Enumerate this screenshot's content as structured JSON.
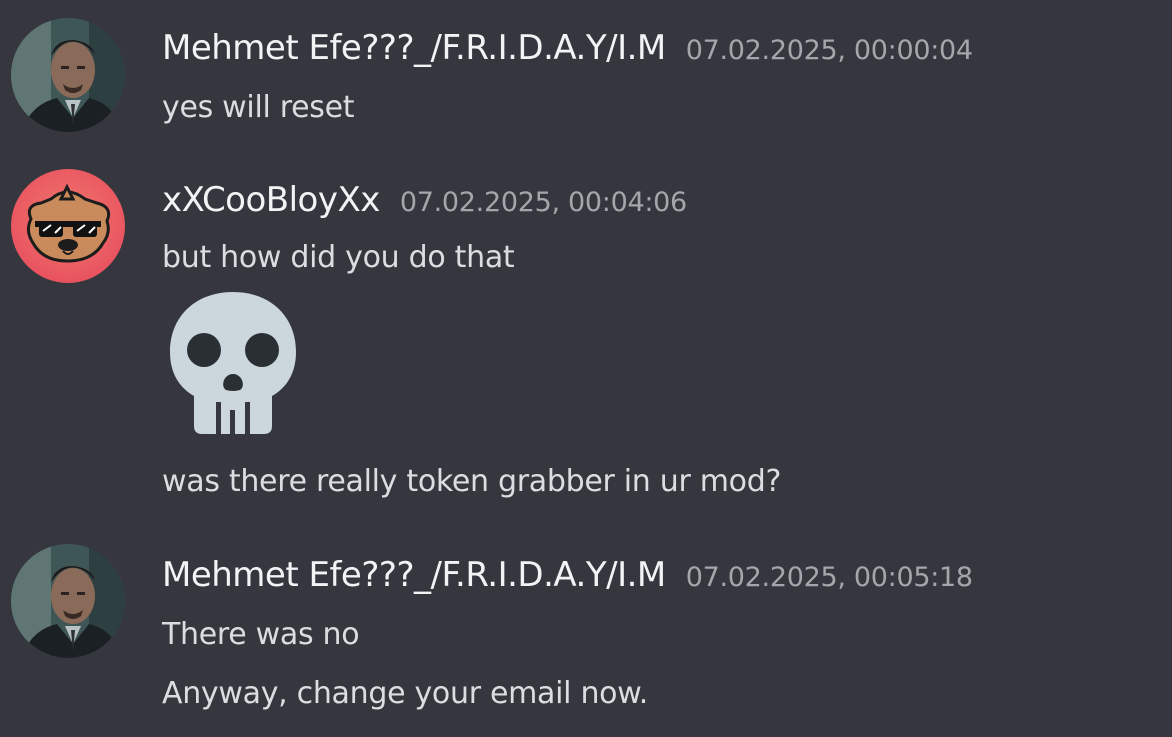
{
  "messages": [
    {
      "author": "Mehmet Efe???_/F.R.I.D.A.Y/I.M",
      "timestamp": "07.02.2025, 00:00:04",
      "lines": [
        "yes will reset"
      ]
    },
    {
      "author": "xXCooBloyXx",
      "timestamp": "07.02.2025, 00:04:06",
      "lines": [
        "but how did you do that",
        "was there really token grabber in ur mod?"
      ],
      "emoji": "skull-emoji"
    },
    {
      "author": "Mehmet Efe???_/F.R.I.D.A.Y/I.M",
      "timestamp": "07.02.2025, 00:05:18",
      "lines": [
        "There was no",
        "Anyway, change your email now."
      ]
    }
  ],
  "colors": {
    "background": "#36373e",
    "username": "#f2f3f5",
    "timestamp": "#a3a6ab",
    "message_text": "#dbdee1",
    "skull": "#ccd6dd",
    "skull_features": "#292f33",
    "avatar2_bg": "#ee5a5f"
  }
}
